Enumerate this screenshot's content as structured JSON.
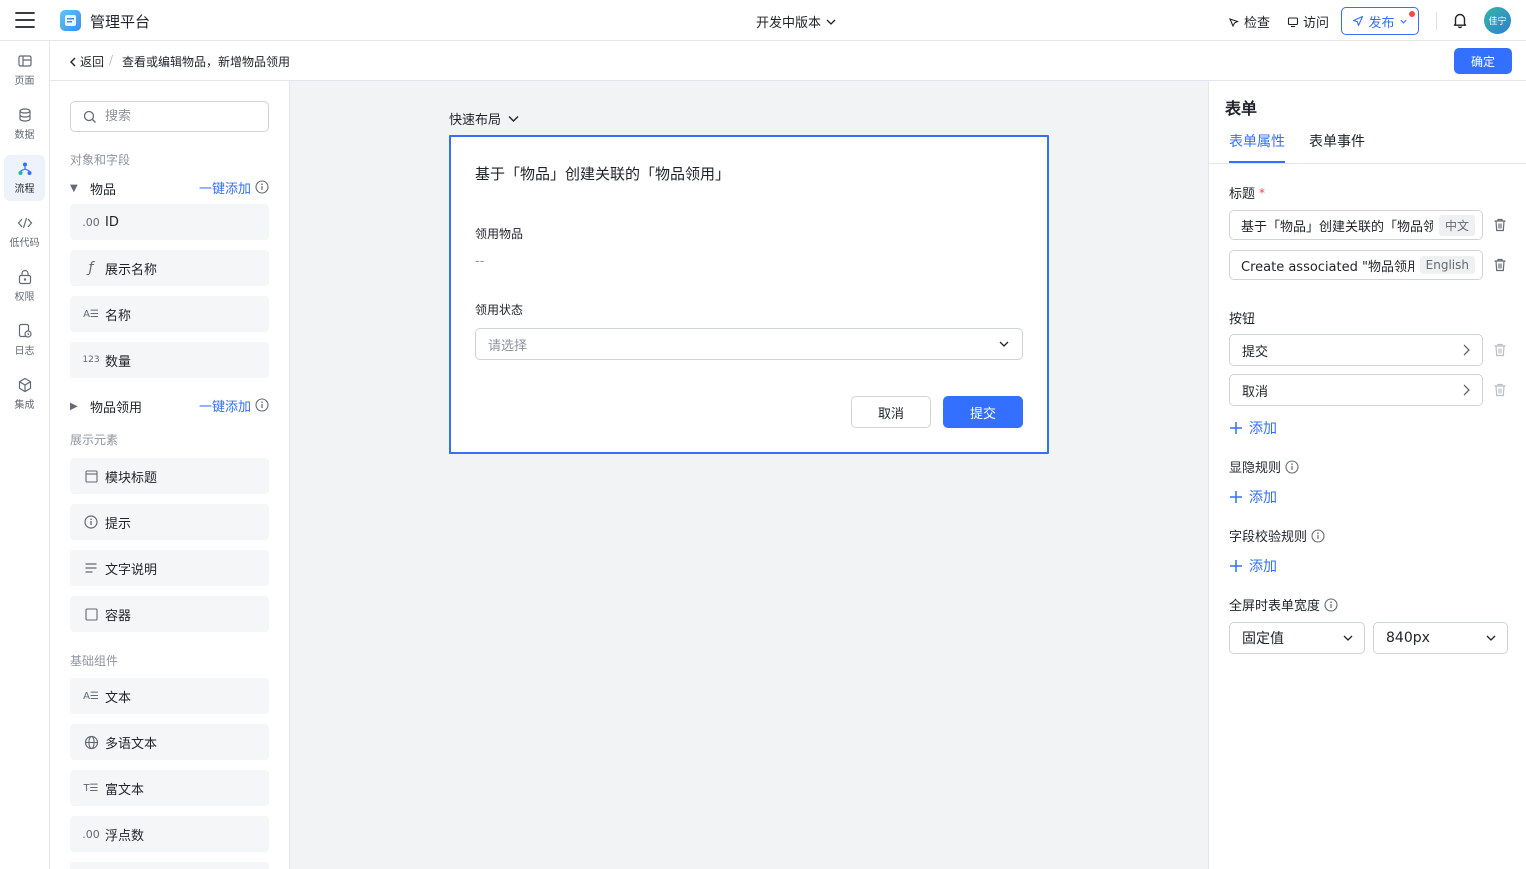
{
  "app": {
    "title": "管理平台",
    "version": "开发中版本"
  },
  "topbar": {
    "inspect": "检查",
    "visit": "访问",
    "publish": "发布",
    "avatar_text": "佳宁"
  },
  "leftrail": {
    "items": [
      {
        "label": "页面",
        "icon": "page-icon"
      },
      {
        "label": "数据",
        "icon": "database-icon"
      },
      {
        "label": "流程",
        "icon": "flow-icon",
        "active": true
      },
      {
        "label": "低代码",
        "icon": "code-icon"
      },
      {
        "label": "权限",
        "icon": "lock-icon"
      },
      {
        "label": "日志",
        "icon": "log-icon"
      },
      {
        "label": "集成",
        "icon": "integration-icon"
      }
    ]
  },
  "breadcrumb": {
    "back": "返回",
    "separator": "/",
    "title": "查看或编辑物品，新增物品领用"
  },
  "header": {
    "confirm": "确定"
  },
  "components": {
    "search_placeholder": "搜索",
    "objects_section": "对象和字段",
    "objects": [
      {
        "name": "物品",
        "add": "一键添加",
        "expanded": true
      },
      {
        "name": "物品领用",
        "add": "一键添加",
        "expanded": false
      }
    ],
    "fields": [
      {
        "icon": ".00",
        "label": "ID"
      },
      {
        "icon": "ƒ",
        "label": "展示名称"
      },
      {
        "icon": "A☰",
        "label": "名称"
      },
      {
        "icon": "123",
        "label": "数量"
      }
    ],
    "display_section": "展示元素",
    "display": [
      {
        "icon": "module-title-icon",
        "label": "模块标题"
      },
      {
        "icon": "info-icon",
        "label": "提示"
      },
      {
        "icon": "text-desc-icon",
        "label": "文字说明"
      },
      {
        "icon": "container-icon",
        "label": "容器"
      }
    ],
    "basic_section": "基础组件",
    "basic": [
      {
        "icon": "A☰",
        "label": "文本"
      },
      {
        "icon": "globe-icon",
        "label": "多语文本"
      },
      {
        "icon": "T☰",
        "label": "富文本"
      },
      {
        "icon": ".00",
        "label": "浮点数"
      }
    ]
  },
  "canvas": {
    "quick_layout": "快速布局",
    "form": {
      "title": "基于「物品」创建关联的「物品领用」",
      "field1_label": "领用物品",
      "field1_value": "--",
      "field2_label": "领用状态",
      "field2_placeholder": "请选择",
      "cancel": "取消",
      "submit": "提交"
    }
  },
  "properties": {
    "panel_title": "表单",
    "tabs": {
      "props": "表单属性",
      "events": "表单事件"
    },
    "title_label": "标题",
    "title_zh": "基于「物品」创建关联的「物品领用」",
    "title_zh_tag": "中文",
    "title_en": "Create associated \"物品领用\" based on \"物品\"",
    "title_en_tag": "English",
    "buttons_label": "按钮",
    "buttons": [
      "提交",
      "取消"
    ],
    "add": "添加",
    "visibility_label": "显隐规则",
    "validation_label": "字段校验规则",
    "width_label": "全屏时表单宽度",
    "width_mode": "固定值",
    "width_value": "840px"
  },
  "colors": {
    "accent": "#3370ff",
    "canvas_bg": "#f2f3f5",
    "danger": "#f54a45"
  }
}
